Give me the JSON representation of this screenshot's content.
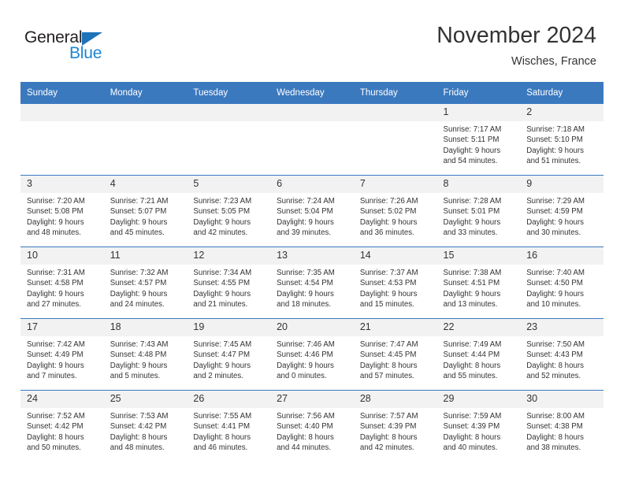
{
  "brand": {
    "name_top": "General",
    "name_bottom": "Blue",
    "triangle_color": "#1c73ba",
    "blue_color": "#1c85d4"
  },
  "header": {
    "title": "November 2024",
    "subtitle": "Wisches, France"
  },
  "theme": {
    "header_bg": "#3b79bf",
    "header_text": "#ffffff",
    "daynum_bg": "#f2f2f2",
    "row_divider": "#3b79bf",
    "body_text": "#333333"
  },
  "calendar": {
    "weekday_headers": [
      "Sunday",
      "Monday",
      "Tuesday",
      "Wednesday",
      "Thursday",
      "Friday",
      "Saturday"
    ],
    "weeks": [
      [
        {
          "day": "",
          "lines": []
        },
        {
          "day": "",
          "lines": []
        },
        {
          "day": "",
          "lines": []
        },
        {
          "day": "",
          "lines": []
        },
        {
          "day": "",
          "lines": []
        },
        {
          "day": "1",
          "lines": [
            "Sunrise: 7:17 AM",
            "Sunset: 5:11 PM",
            "Daylight: 9 hours",
            "and 54 minutes."
          ]
        },
        {
          "day": "2",
          "lines": [
            "Sunrise: 7:18 AM",
            "Sunset: 5:10 PM",
            "Daylight: 9 hours",
            "and 51 minutes."
          ]
        }
      ],
      [
        {
          "day": "3",
          "lines": [
            "Sunrise: 7:20 AM",
            "Sunset: 5:08 PM",
            "Daylight: 9 hours",
            "and 48 minutes."
          ]
        },
        {
          "day": "4",
          "lines": [
            "Sunrise: 7:21 AM",
            "Sunset: 5:07 PM",
            "Daylight: 9 hours",
            "and 45 minutes."
          ]
        },
        {
          "day": "5",
          "lines": [
            "Sunrise: 7:23 AM",
            "Sunset: 5:05 PM",
            "Daylight: 9 hours",
            "and 42 minutes."
          ]
        },
        {
          "day": "6",
          "lines": [
            "Sunrise: 7:24 AM",
            "Sunset: 5:04 PM",
            "Daylight: 9 hours",
            "and 39 minutes."
          ]
        },
        {
          "day": "7",
          "lines": [
            "Sunrise: 7:26 AM",
            "Sunset: 5:02 PM",
            "Daylight: 9 hours",
            "and 36 minutes."
          ]
        },
        {
          "day": "8",
          "lines": [
            "Sunrise: 7:28 AM",
            "Sunset: 5:01 PM",
            "Daylight: 9 hours",
            "and 33 minutes."
          ]
        },
        {
          "day": "9",
          "lines": [
            "Sunrise: 7:29 AM",
            "Sunset: 4:59 PM",
            "Daylight: 9 hours",
            "and 30 minutes."
          ]
        }
      ],
      [
        {
          "day": "10",
          "lines": [
            "Sunrise: 7:31 AM",
            "Sunset: 4:58 PM",
            "Daylight: 9 hours",
            "and 27 minutes."
          ]
        },
        {
          "day": "11",
          "lines": [
            "Sunrise: 7:32 AM",
            "Sunset: 4:57 PM",
            "Daylight: 9 hours",
            "and 24 minutes."
          ]
        },
        {
          "day": "12",
          "lines": [
            "Sunrise: 7:34 AM",
            "Sunset: 4:55 PM",
            "Daylight: 9 hours",
            "and 21 minutes."
          ]
        },
        {
          "day": "13",
          "lines": [
            "Sunrise: 7:35 AM",
            "Sunset: 4:54 PM",
            "Daylight: 9 hours",
            "and 18 minutes."
          ]
        },
        {
          "day": "14",
          "lines": [
            "Sunrise: 7:37 AM",
            "Sunset: 4:53 PM",
            "Daylight: 9 hours",
            "and 15 minutes."
          ]
        },
        {
          "day": "15",
          "lines": [
            "Sunrise: 7:38 AM",
            "Sunset: 4:51 PM",
            "Daylight: 9 hours",
            "and 13 minutes."
          ]
        },
        {
          "day": "16",
          "lines": [
            "Sunrise: 7:40 AM",
            "Sunset: 4:50 PM",
            "Daylight: 9 hours",
            "and 10 minutes."
          ]
        }
      ],
      [
        {
          "day": "17",
          "lines": [
            "Sunrise: 7:42 AM",
            "Sunset: 4:49 PM",
            "Daylight: 9 hours",
            "and 7 minutes."
          ]
        },
        {
          "day": "18",
          "lines": [
            "Sunrise: 7:43 AM",
            "Sunset: 4:48 PM",
            "Daylight: 9 hours",
            "and 5 minutes."
          ]
        },
        {
          "day": "19",
          "lines": [
            "Sunrise: 7:45 AM",
            "Sunset: 4:47 PM",
            "Daylight: 9 hours",
            "and 2 minutes."
          ]
        },
        {
          "day": "20",
          "lines": [
            "Sunrise: 7:46 AM",
            "Sunset: 4:46 PM",
            "Daylight: 9 hours",
            "and 0 minutes."
          ]
        },
        {
          "day": "21",
          "lines": [
            "Sunrise: 7:47 AM",
            "Sunset: 4:45 PM",
            "Daylight: 8 hours",
            "and 57 minutes."
          ]
        },
        {
          "day": "22",
          "lines": [
            "Sunrise: 7:49 AM",
            "Sunset: 4:44 PM",
            "Daylight: 8 hours",
            "and 55 minutes."
          ]
        },
        {
          "day": "23",
          "lines": [
            "Sunrise: 7:50 AM",
            "Sunset: 4:43 PM",
            "Daylight: 8 hours",
            "and 52 minutes."
          ]
        }
      ],
      [
        {
          "day": "24",
          "lines": [
            "Sunrise: 7:52 AM",
            "Sunset: 4:42 PM",
            "Daylight: 8 hours",
            "and 50 minutes."
          ]
        },
        {
          "day": "25",
          "lines": [
            "Sunrise: 7:53 AM",
            "Sunset: 4:42 PM",
            "Daylight: 8 hours",
            "and 48 minutes."
          ]
        },
        {
          "day": "26",
          "lines": [
            "Sunrise: 7:55 AM",
            "Sunset: 4:41 PM",
            "Daylight: 8 hours",
            "and 46 minutes."
          ]
        },
        {
          "day": "27",
          "lines": [
            "Sunrise: 7:56 AM",
            "Sunset: 4:40 PM",
            "Daylight: 8 hours",
            "and 44 minutes."
          ]
        },
        {
          "day": "28",
          "lines": [
            "Sunrise: 7:57 AM",
            "Sunset: 4:39 PM",
            "Daylight: 8 hours",
            "and 42 minutes."
          ]
        },
        {
          "day": "29",
          "lines": [
            "Sunrise: 7:59 AM",
            "Sunset: 4:39 PM",
            "Daylight: 8 hours",
            "and 40 minutes."
          ]
        },
        {
          "day": "30",
          "lines": [
            "Sunrise: 8:00 AM",
            "Sunset: 4:38 PM",
            "Daylight: 8 hours",
            "and 38 minutes."
          ]
        }
      ]
    ]
  }
}
